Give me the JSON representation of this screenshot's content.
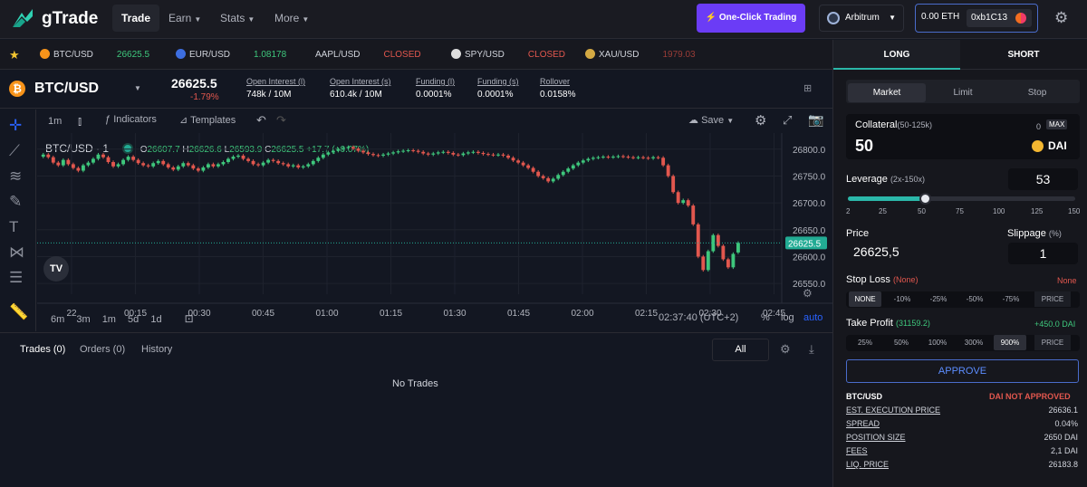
{
  "app": {
    "brand": "gTrade"
  },
  "nav": {
    "trade": "Trade",
    "earn": "Earn",
    "stats": "Stats",
    "more": "More"
  },
  "header": {
    "one_click": "⚡ One-Click Trading",
    "network": "Arbitrum",
    "balance": "0.00 ETH",
    "address": "0xb1C13"
  },
  "ticker": [
    {
      "pair": "BTC/USD",
      "price": "26625.5",
      "status": "green",
      "color": "#f7931a"
    },
    {
      "pair": "EUR/USD",
      "price": "1.08178",
      "status": "green",
      "color": "#3d6ee0"
    },
    {
      "pair": "AAPL/USD",
      "price": "CLOSED",
      "status": "red",
      "color": "#cccccc"
    },
    {
      "pair": "SPY/USD",
      "price": "CLOSED",
      "status": "red",
      "color": "#dddddd"
    },
    {
      "pair": "XAU/USD",
      "price": "1979.03",
      "status": "red",
      "color": "#d4a943"
    }
  ],
  "pair": {
    "name": "BTC/USD",
    "price": "26625.5",
    "change": "-1.79%",
    "stats": [
      {
        "label": "Open Interest (l)",
        "value": "748k / 10M",
        "color": "#ffffff"
      },
      {
        "label": "Open Interest (s)",
        "value": "610.4k / 10M",
        "color": "#ffffff"
      },
      {
        "label": "Funding (l)",
        "value": "0.0001%",
        "color": "#e2574e"
      },
      {
        "label": "Funding (s)",
        "value": "0.0001%",
        "color": "#3ec77c"
      },
      {
        "label": "Rollover",
        "value": "0.0158%",
        "color": "#e2574e"
      }
    ]
  },
  "chart_toolbar": {
    "interval": "1m",
    "indicators": "Indicators",
    "templates": "Templates",
    "save": "Save"
  },
  "chart_legend": {
    "symbol": "BTC/USD · 1",
    "o": "O",
    "o_val": "26607.7",
    "h": "H",
    "h_val": "26626.6",
    "l": "L",
    "l_val": "26593.9",
    "c": "C",
    "c_val": "26625.5",
    "chg": "+17.7 (+0.07%)"
  },
  "chart_data": {
    "type": "candlestick",
    "yticks": [
      "26800.0",
      "26750.0",
      "26700.0",
      "26650.0",
      "26600.0",
      "26550.0"
    ],
    "ytick_values": [
      26800,
      26750,
      26700,
      26650,
      26600,
      26550
    ],
    "xticks": [
      "22",
      "00:15",
      "00:30",
      "00:45",
      "01:00",
      "01:15",
      "01:30",
      "01:45",
      "02:00",
      "02:15",
      "02:30",
      "02:45"
    ],
    "last_price": "26625.5",
    "ylim": [
      26530,
      26830
    ],
    "closes": [
      26790,
      26785,
      26775,
      26770,
      26780,
      26772,
      26765,
      26760,
      26770,
      26775,
      26782,
      26790,
      26785,
      26776,
      26768,
      26772,
      26780,
      26786,
      26780,
      26774,
      26770,
      26768,
      26774,
      26778,
      26772,
      26766,
      26762,
      26768,
      26774,
      26770,
      26764,
      26760,
      26766,
      26772,
      26768,
      26772,
      26776,
      26782,
      26786,
      26788,
      26782,
      26778,
      26772,
      26770,
      26775,
      26780,
      26778,
      26774,
      26772,
      26768,
      26770,
      26766,
      26768,
      26772,
      26778,
      26784,
      26790,
      26794,
      26797,
      26800,
      26802,
      26804,
      26801,
      26797,
      26794,
      26791,
      26789,
      26788,
      26790,
      26792,
      26794,
      26796,
      26797,
      26798,
      26797,
      26795,
      26792,
      26790,
      26792,
      26794,
      26795,
      26793,
      26790,
      26789,
      26792,
      26794,
      26795,
      26793,
      26791,
      26790,
      26789,
      26790,
      26788,
      26784,
      26779,
      26775,
      26770,
      26765,
      26758,
      26750,
      26746,
      26740,
      26745,
      26752,
      26758,
      26764,
      26770,
      26775,
      26779,
      26782,
      26784,
      26785,
      26786,
      26785,
      26786,
      26787,
      26786,
      26785,
      26784,
      26785,
      26784,
      26783,
      26785,
      26784,
      26770,
      26750,
      26720,
      26700,
      26705,
      26695,
      26660,
      26600,
      26575,
      26610,
      26640,
      26620,
      26595,
      26580,
      26605,
      26625.5
    ],
    "opens": [
      26786,
      26790,
      26785,
      26775,
      26770,
      26780,
      26772,
      26765,
      26760,
      26770,
      26775,
      26782,
      26790,
      26785,
      26776,
      26768,
      26772,
      26780,
      26786,
      26780,
      26774,
      26770,
      26768,
      26774,
      26778,
      26772,
      26766,
      26762,
      26768,
      26774,
      26770,
      26764,
      26760,
      26766,
      26772,
      26768,
      26772,
      26776,
      26782,
      26786,
      26788,
      26782,
      26778,
      26772,
      26770,
      26775,
      26780,
      26778,
      26774,
      26772,
      26768,
      26770,
      26766,
      26768,
      26772,
      26778,
      26784,
      26790,
      26794,
      26797,
      26800,
      26802,
      26804,
      26801,
      26797,
      26794,
      26791,
      26789,
      26788,
      26790,
      26792,
      26794,
      26796,
      26797,
      26798,
      26797,
      26795,
      26792,
      26790,
      26792,
      26794,
      26795,
      26793,
      26790,
      26789,
      26792,
      26794,
      26795,
      26793,
      26791,
      26790,
      26789,
      26790,
      26788,
      26784,
      26779,
      26775,
      26770,
      26765,
      26758,
      26750,
      26746,
      26740,
      26745,
      26752,
      26758,
      26764,
      26770,
      26775,
      26779,
      26782,
      26784,
      26785,
      26786,
      26785,
      26786,
      26787,
      26786,
      26785,
      26784,
      26785,
      26784,
      26783,
      26785,
      26784,
      26770,
      26750,
      26720,
      26700,
      26705,
      26695,
      26660,
      26600,
      26575,
      26610,
      26640,
      26620,
      26595,
      26580,
      26607.7
    ]
  },
  "chart_bottom": {
    "ranges": [
      "6m",
      "3m",
      "1m",
      "5d",
      "1d"
    ],
    "time": "02:37:40 (UTC+2)",
    "pct": "%",
    "log": "log",
    "auto": "auto"
  },
  "trades_tabs": {
    "trades": "Trades (0)",
    "orders": "Orders (0)",
    "history": "History",
    "filter": "All",
    "empty": "No Trades"
  },
  "panel": {
    "long": "LONG",
    "short": "SHORT",
    "order_types": [
      "Market",
      "Limit",
      "Stop"
    ],
    "collateral_label": "Collateral",
    "collateral_range": "(50-125k)",
    "collateral_balance": "0",
    "max": "MAX",
    "collateral_value": "50",
    "collateral_token": "DAI",
    "leverage_label": "Leverage",
    "leverage_range": "(2x-150x)",
    "leverage_value": "53",
    "leverage_fraction": 0.34,
    "leverage_ticks": [
      "2",
      "25",
      "50",
      "75",
      "100",
      "125",
      "150"
    ],
    "price_label": "Price",
    "price_value": "26625,5",
    "slippage_label": "Slippage",
    "slippage_unit": "(%)",
    "slippage_value": "1",
    "sl_label": "Stop Loss",
    "sl_note": "(None)",
    "sl_value": "None",
    "sl_chips": [
      "NONE",
      "-10%",
      "-25%",
      "-50%",
      "-75%",
      "PRICE"
    ],
    "tp_label": "Take Profit",
    "tp_note": "(31159.2)",
    "tp_value": "+450.0 DAI",
    "tp_chips": [
      "25%",
      "50%",
      "100%",
      "300%",
      "900%",
      "PRICE"
    ],
    "approve": "APPROVE",
    "summary_pair": "BTC/USD",
    "summary_status": "DAI NOT APPROVED",
    "rows": [
      {
        "k": "EST. EXECUTION PRICE",
        "v": "26636.1"
      },
      {
        "k": "SPREAD",
        "v": "0.04%"
      },
      {
        "k": "POSITION SIZE",
        "v": "2650 DAI"
      },
      {
        "k": "FEES",
        "v": "2,1 DAI"
      },
      {
        "k": "LIQ. PRICE",
        "v": "26183.8"
      }
    ]
  },
  "colors": {
    "up": "#3ec77c",
    "down": "#e2574e",
    "accent": "#2bb7a9",
    "purple": "#6b3cf6"
  }
}
